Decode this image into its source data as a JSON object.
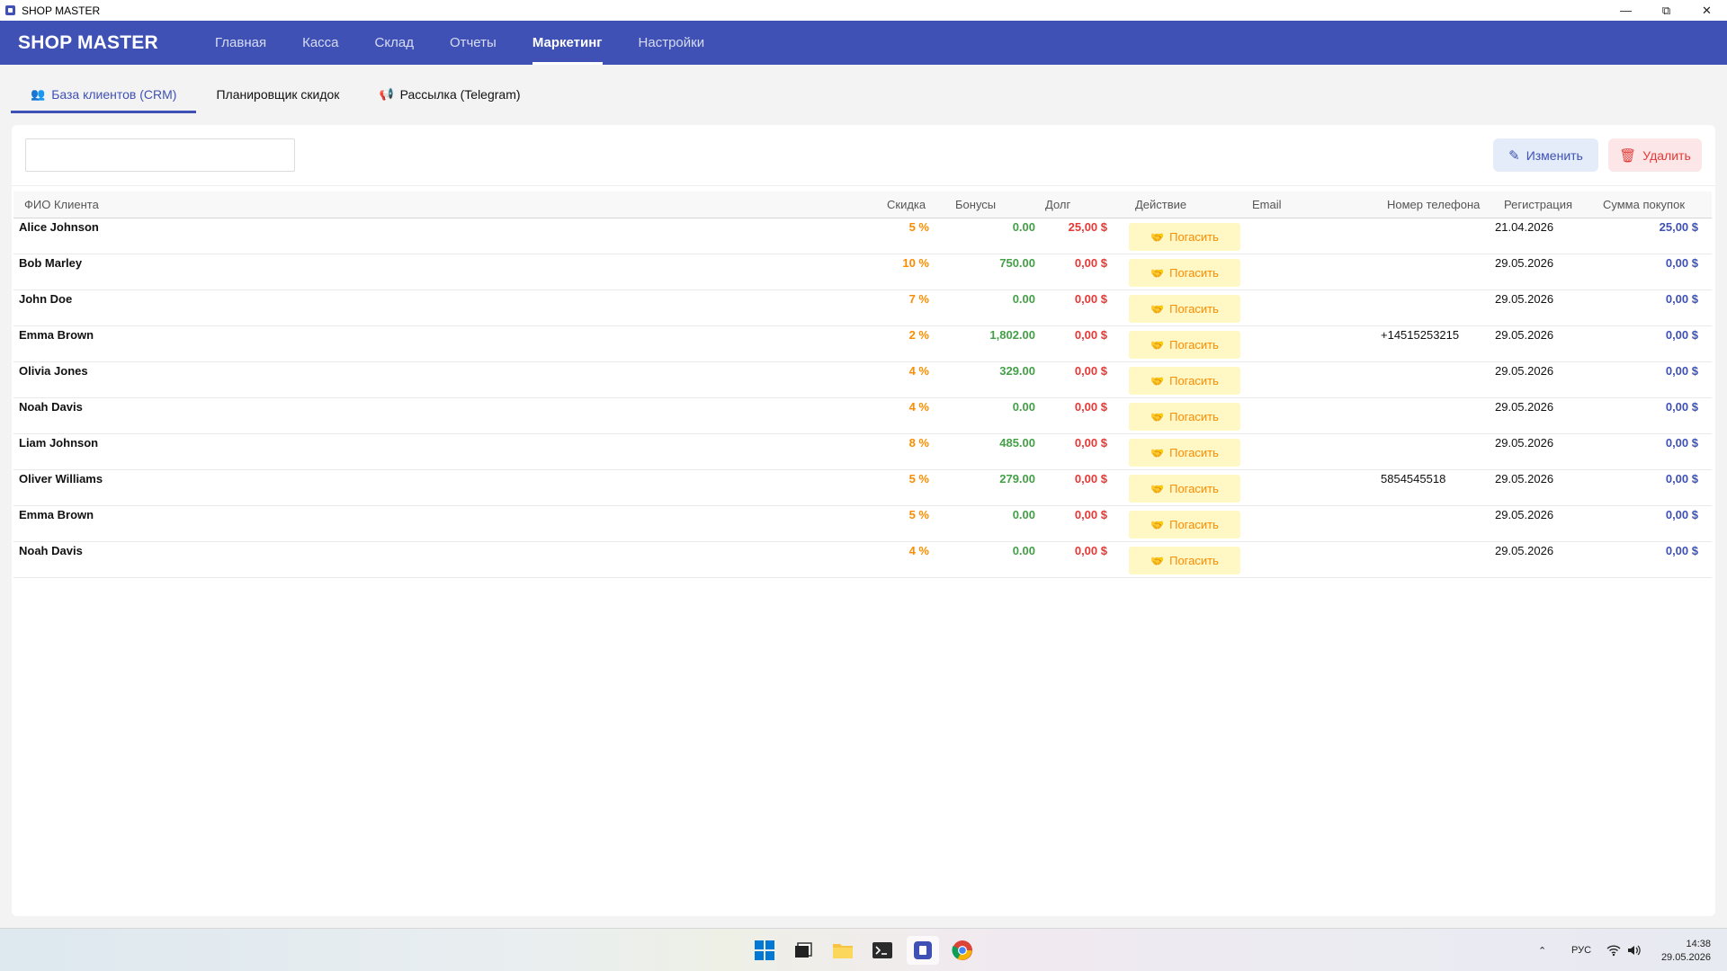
{
  "window": {
    "title": "SHOP MASTER"
  },
  "brand": "SHOP MASTER",
  "nav": [
    {
      "label": "Главная",
      "active": false
    },
    {
      "label": "Касса",
      "active": false
    },
    {
      "label": "Склад",
      "active": false
    },
    {
      "label": "Отчеты",
      "active": false
    },
    {
      "label": "Маркетинг",
      "active": true
    },
    {
      "label": "Настройки",
      "active": false
    }
  ],
  "subtabs": [
    {
      "label": "База клиентов (CRM)",
      "icon": "users-icon",
      "active": true
    },
    {
      "label": "Планировщик скидок",
      "icon": "",
      "active": false
    },
    {
      "label": "Рассылка (Telegram)",
      "icon": "megaphone-icon",
      "active": false
    }
  ],
  "toolbar": {
    "search_value": "",
    "edit_label": "Изменить",
    "delete_label": "Удалить"
  },
  "table": {
    "headers": {
      "name": "ФИО Клиента",
      "discount": "Скидка",
      "bonus": "Бонусы",
      "debt": "Долг",
      "action": "Действие",
      "email": "Email",
      "phone": "Номер телефона",
      "registered": "Регистрация",
      "total": "Сумма покупок"
    },
    "pay_label": "Погасить",
    "rows": [
      {
        "name": "Alice Johnson",
        "discount": "5 %",
        "bonus": "0.00",
        "debt": "25,00 $",
        "email": "",
        "phone": "",
        "registered": "21.04.2026",
        "total": "25,00 $"
      },
      {
        "name": "Bob Marley",
        "discount": "10 %",
        "bonus": "750.00",
        "debt": "0,00 $",
        "email": "",
        "phone": "",
        "registered": "29.05.2026",
        "total": "0,00 $"
      },
      {
        "name": "John Doe",
        "discount": "7 %",
        "bonus": "0.00",
        "debt": "0,00 $",
        "email": "",
        "phone": "",
        "registered": "29.05.2026",
        "total": "0,00 $"
      },
      {
        "name": "Emma Brown",
        "discount": "2 %",
        "bonus": "1,802.00",
        "debt": "0,00 $",
        "email": "",
        "phone": "+14515253215",
        "registered": "29.05.2026",
        "total": "0,00 $"
      },
      {
        "name": "Olivia Jones",
        "discount": "4 %",
        "bonus": "329.00",
        "debt": "0,00 $",
        "email": "",
        "phone": "",
        "registered": "29.05.2026",
        "total": "0,00 $"
      },
      {
        "name": "Noah Davis",
        "discount": "4 %",
        "bonus": "0.00",
        "debt": "0,00 $",
        "email": "",
        "phone": "",
        "registered": "29.05.2026",
        "total": "0,00 $"
      },
      {
        "name": "Liam Johnson",
        "discount": "8 %",
        "bonus": "485.00",
        "debt": "0,00 $",
        "email": "",
        "phone": "",
        "registered": "29.05.2026",
        "total": "0,00 $"
      },
      {
        "name": "Oliver Williams",
        "discount": "5 %",
        "bonus": "279.00",
        "debt": "0,00 $",
        "email": "",
        "phone": "5854545518",
        "registered": "29.05.2026",
        "total": "0,00 $"
      },
      {
        "name": "Emma Brown",
        "discount": "5 %",
        "bonus": "0.00",
        "debt": "0,00 $",
        "email": "",
        "phone": "",
        "registered": "29.05.2026",
        "total": "0,00 $"
      },
      {
        "name": "Noah Davis",
        "discount": "4 %",
        "bonus": "0.00",
        "debt": "0,00 $",
        "email": "",
        "phone": "",
        "registered": "29.05.2026",
        "total": "0,00 $"
      }
    ]
  },
  "taskbar": {
    "language": "РУС",
    "time": "14:38",
    "date": "29.05.2026"
  },
  "colors": {
    "primary": "#3f51b5",
    "discount": "#fb8c00",
    "bonus": "#43a047",
    "debt": "#e53935"
  }
}
